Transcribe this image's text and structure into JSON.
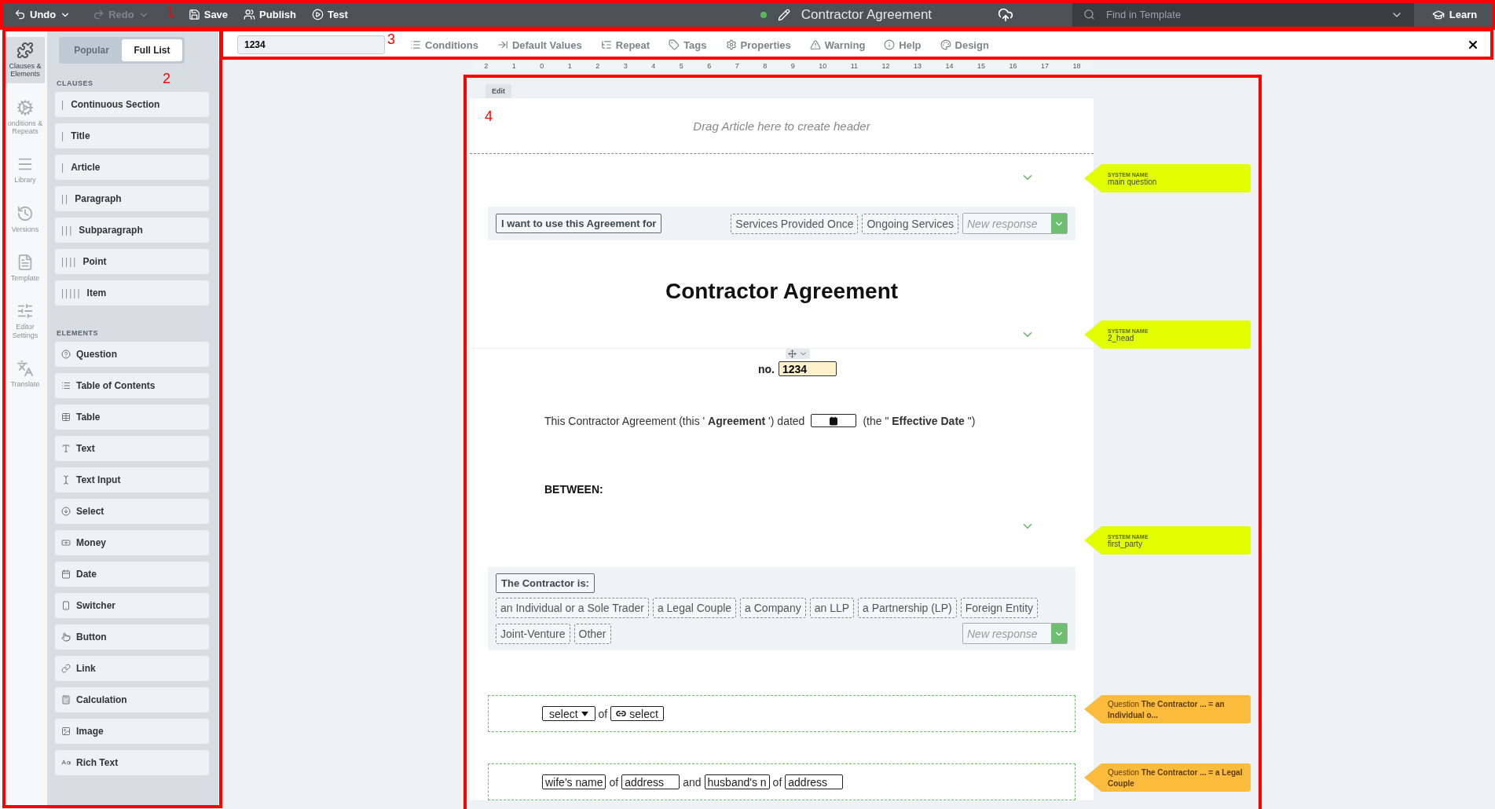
{
  "topbar": {
    "undo": {
      "label": "Undo",
      "disabled": false
    },
    "redo": {
      "label": "Redo",
      "disabled": true
    },
    "actions": [
      "Save",
      "Publish",
      "Test"
    ],
    "title": "Contractor Agreement",
    "search": {
      "placeholder": "Find in Template"
    },
    "learn": "Learn"
  },
  "rail": [
    {
      "label": "Clauses & Elements",
      "selected": true
    },
    {
      "label": "onditions & Repeats",
      "selected": false
    },
    {
      "label": "Library",
      "selected": false
    },
    {
      "label": "Versions",
      "selected": false
    },
    {
      "label": "Template",
      "selected": false
    },
    {
      "label": "Editor Settings",
      "selected": false
    },
    {
      "label": "Translate",
      "selected": false
    }
  ],
  "sidebar": {
    "tabs": [
      {
        "label": "Popular",
        "selected": false
      },
      {
        "label": "Full List",
        "selected": true
      }
    ],
    "clauses_heading": "CLAUSES",
    "clauses": [
      {
        "marker": "|",
        "label": "Continuous Section"
      },
      {
        "marker": "|",
        "label": "Title"
      },
      {
        "marker": "|",
        "label": "Article"
      },
      {
        "marker": "||",
        "label": "Paragraph"
      },
      {
        "marker": "|||",
        "label": "Subparagraph"
      },
      {
        "marker": "||||",
        "label": "Point"
      },
      {
        "marker": "|||||",
        "label": "Item"
      }
    ],
    "elements_heading": "ELEMENTS",
    "elements": [
      "Question",
      "Table of Contents",
      "Table",
      "Text",
      "Text Input",
      "Select",
      "Money",
      "Date",
      "Switcher",
      "Button",
      "Link",
      "Calculation",
      "Image",
      "Rich Text"
    ]
  },
  "toolbar": {
    "field_value": "1234",
    "buttons": [
      "Conditions",
      "Default Values",
      "Repeat",
      "Tags",
      "Properties",
      "Warning",
      "Help",
      "Design"
    ]
  },
  "ruler": [
    "2",
    "1",
    "0",
    "1",
    "2",
    "3",
    "4",
    "5",
    "6",
    "7",
    "8",
    "9",
    "10",
    "11",
    "12",
    "13",
    "14",
    "15",
    "16",
    "17",
    "18"
  ],
  "document": [
    {
      "kind": "header",
      "edit": "Edit",
      "hint": "Drag Article here to create header"
    },
    {
      "kind": "marker",
      "tag": {
        "kind": "system",
        "label": "SYSTEM NAME",
        "value": "main question",
        "color": "#e2ff00"
      }
    },
    {
      "kind": "question",
      "prompt": "I want to use this Agreement for",
      "options": [
        "Services Provided Once",
        "Ongoing Services"
      ],
      "placeholder": "New response"
    },
    {
      "kind": "heading",
      "text": "Contractor Agreement"
    },
    {
      "kind": "marker",
      "tag": {
        "kind": "system",
        "label": "SYSTEM NAME",
        "value": "2_head",
        "color": "#e2ff00"
      }
    },
    {
      "kind": "number",
      "label": "no.",
      "value": "1234"
    },
    {
      "kind": "paragraph",
      "before": "This Contractor Agreement (this ' **Agreement** ') dated",
      "after": "(the \" **Effective Date** \")"
    },
    {
      "kind": "bold",
      "text": "BETWEEN:"
    },
    {
      "kind": "marker",
      "tag": {
        "kind": "system",
        "label": "SYSTEM NAME",
        "value": "first_party",
        "color": "#e2ff00"
      }
    },
    {
      "kind": "question_wide",
      "prompt": "The Contractor is:",
      "options": [
        "an Individual or a Sole Trader",
        "a Legal Couple",
        "a Company",
        "an LLP",
        "a Partnership (LP)",
        "Foreign Entity",
        "Joint-Venture",
        "Other"
      ],
      "placeholder": "New response"
    },
    {
      "kind": "condition",
      "items": [
        {
          "kind": "dropdown",
          "text": "select"
        },
        {
          "kind": "word",
          "text": "of"
        },
        {
          "kind": "link",
          "text": "select"
        }
      ],
      "tag": {
        "kind": "condition",
        "text": "Question **The Contractor ... = an Individual o...**",
        "color": "#fbbb3c"
      }
    },
    {
      "kind": "condition",
      "items": [
        {
          "kind": "field",
          "text": "wife's name"
        },
        {
          "kind": "word",
          "text": "of"
        },
        {
          "kind": "field",
          "text": "address"
        },
        {
          "kind": "word",
          "text": "and"
        },
        {
          "kind": "field",
          "text": "husband's n"
        },
        {
          "kind": "word",
          "text": "of"
        },
        {
          "kind": "field",
          "text": "address"
        }
      ],
      "tag": {
        "kind": "condition",
        "text": "Question **The Contractor ... = a Legal Couple**",
        "color": "#fbbb3c"
      }
    }
  ],
  "annotations": [
    "1",
    "2",
    "3",
    "4"
  ]
}
